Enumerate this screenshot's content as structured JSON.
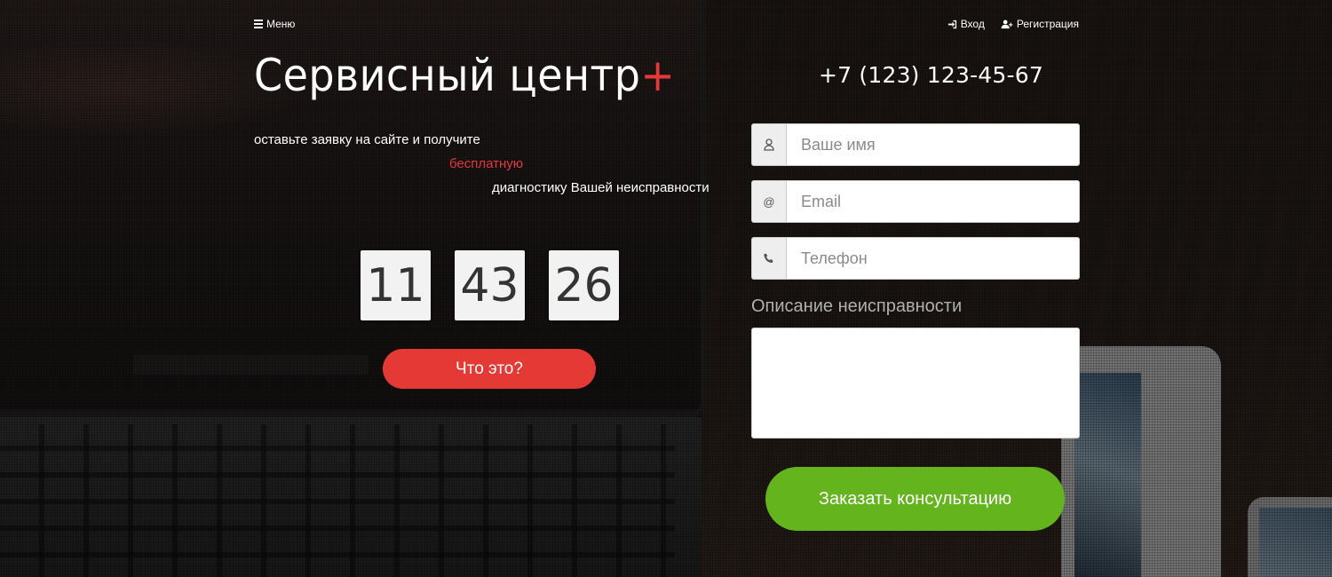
{
  "nav": {
    "menu_label": "Меню",
    "login_label": "Вход",
    "register_label": "Регистрация"
  },
  "hero": {
    "logo_text": "Сервисный центр",
    "logo_plus": "+",
    "tagline_line1": "оставьте заявку на сайте и получите",
    "tagline_line2": "бесплатную",
    "tagline_line3": "диагностику Вашей неисправности"
  },
  "timer": {
    "hours": "11",
    "minutes": "43",
    "seconds": "26"
  },
  "what_button_label": "Что это?",
  "contact": {
    "phone": "+7 (123) 123-45-67"
  },
  "form": {
    "name_placeholder": "Ваше имя",
    "email_placeholder": "Email",
    "phone_placeholder": "Телефон",
    "email_addon": "@",
    "description_label": "Описание неисправности",
    "submit_label": "Заказать консультацию"
  },
  "colors": {
    "accent_red": "#e53935",
    "submit_green": "#64b41e"
  }
}
